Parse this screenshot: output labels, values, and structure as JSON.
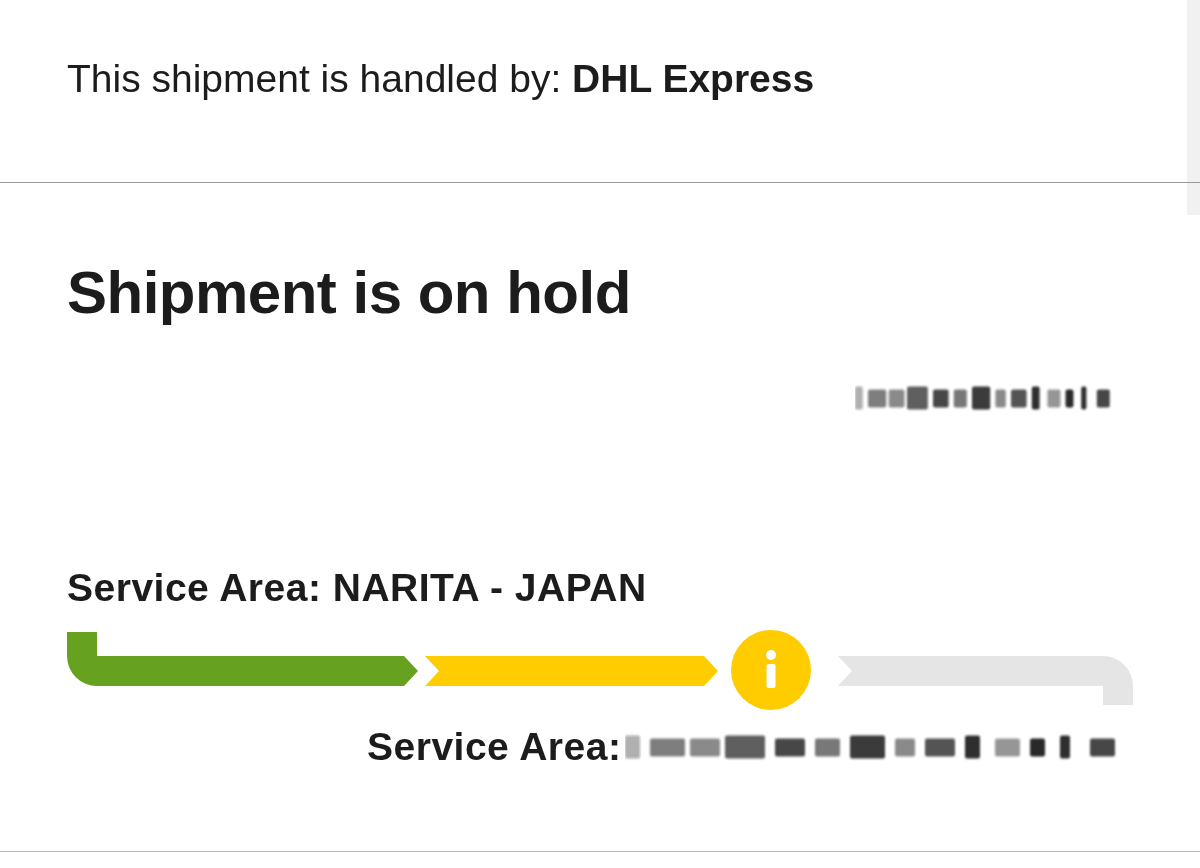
{
  "handler_line": "This shipment is handled by: **DHL Express**",
  "status_title": "Shipment is on hold",
  "status_detail": {
    "redacted": true
  },
  "origin": "Service Area: NARITA - JAPAN",
  "progress": {
    "segments": [
      {
        "kind": "done"
      },
      {
        "kind": "held"
      },
      {
        "kind": "pending"
      }
    ]
  },
  "destination": {
    "label": "Service Area:",
    "redacted": true
  }
}
